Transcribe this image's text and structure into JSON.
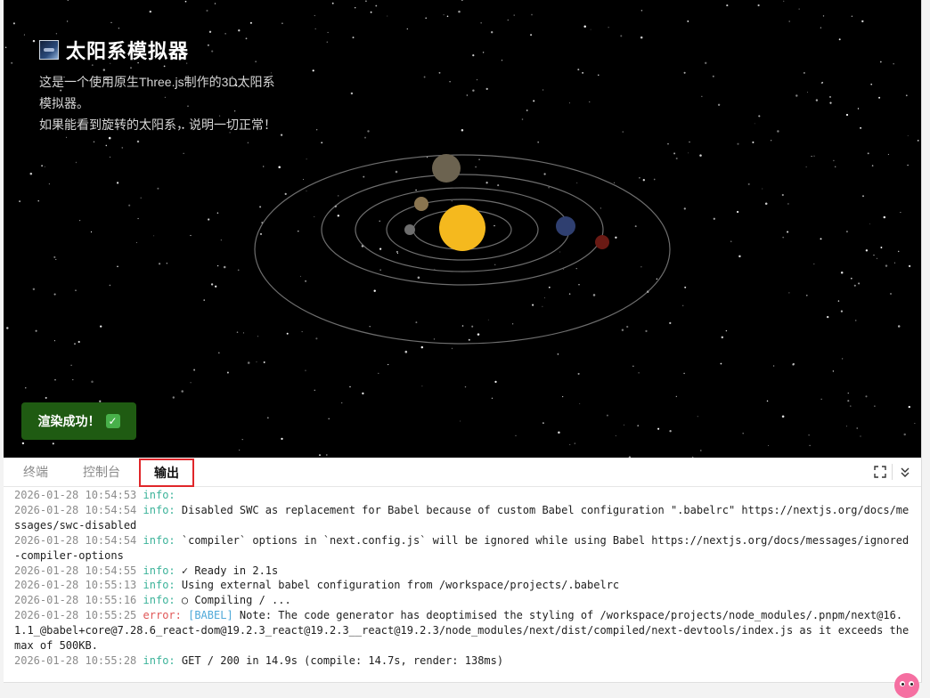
{
  "scene": {
    "title": "太阳系模拟器",
    "title_icon": "image-icon",
    "description": [
      "这是一个使用原生Three.js制作的3D太阳系模拟器。",
      "如果能看到旋转的太阳系，说明一切正常！"
    ],
    "toast": "渲染成功！",
    "toast_icon": "check-mark-icon",
    "colors": {
      "background": "#000000",
      "sun": "#f5b91e",
      "toast": "#1f5b12",
      "orbit": "#9a9a9a"
    }
  },
  "panel": {
    "tabs": [
      {
        "label": "终端",
        "active": false
      },
      {
        "label": "控制台",
        "active": false
      },
      {
        "label": "输出",
        "active": true
      }
    ],
    "actions": {
      "fullscreen_icon": "expand-icon",
      "collapse_icon": "chevrons-down-icon"
    }
  },
  "log": [
    {
      "ts": "2026-01-28 10:54:53",
      "level": "info:",
      "tag": "",
      "msg": ""
    },
    {
      "ts": "2026-01-28 10:54:54",
      "level": "info:",
      "tag": "",
      "msg": "Disabled SWC as replacement for Babel because of custom Babel configuration \".babelrc\" https://nextjs.org/docs/messages/swc-disabled"
    },
    {
      "ts": "2026-01-28 10:54:54",
      "level": "info:",
      "tag": "",
      "msg": "`compiler` options in `next.config.js` will be ignored while using Babel https://nextjs.org/docs/messages/ignored-compiler-options"
    },
    {
      "ts": "2026-01-28 10:54:55",
      "level": "info:",
      "tag": "",
      "msg": "✓ Ready in 2.1s"
    },
    {
      "ts": "2026-01-28 10:55:13",
      "level": "info:",
      "tag": "",
      "msg": "Using external babel configuration from /workspace/projects/.babelrc"
    },
    {
      "ts": "2026-01-28 10:55:16",
      "level": "info:",
      "tag": "",
      "msg": "○ Compiling / ..."
    },
    {
      "ts": "2026-01-28 10:55:25",
      "level": "error:",
      "tag": "[BABEL]",
      "msg": "Note: The code generator has deoptimised the styling of /workspace/projects/node_modules/.pnpm/next@16.1.1_@babel+core@7.28.6_react-dom@19.2.3_react@19.2.3__react@19.2.3/node_modules/next/dist/compiled/next-devtools/index.js as it exceeds the max of 500KB."
    },
    {
      "ts": "2026-01-28 10:55:28",
      "level": "info:",
      "tag": "",
      "msg": "GET / 200 in 14.9s (compile: 14.7s, render: 138ms)"
    }
  ],
  "mascot_icon": "mascot-icon"
}
